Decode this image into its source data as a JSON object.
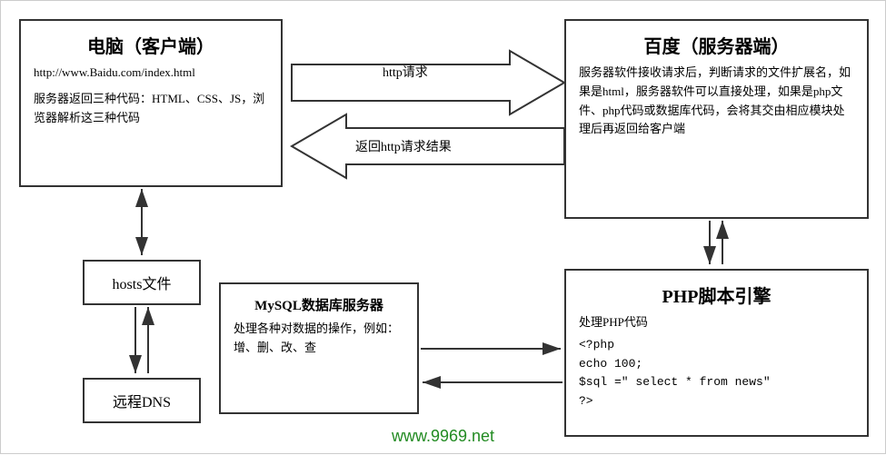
{
  "client": {
    "title": "电脑（客户端）",
    "url": "http://www.Baidu.com/index.html",
    "description": "服务器返回三种代码：HTML、CSS、JS，浏览器解析这三种代码"
  },
  "server": {
    "title": "百度（服务器端）",
    "description": "服务器软件接收请求后，判断请求的文件扩展名，如果是html，服务器软件可以直接处理，如果是php文件、php代码或数据库代码，会将其交由相应模块处理后再返回给客户端"
  },
  "hosts": {
    "label": "hosts文件"
  },
  "dns": {
    "label": "远程DNS"
  },
  "mysql": {
    "title": "MySQL数据库服务器",
    "description": "处理各种对数据的操作，例如：增、删、改、查"
  },
  "php": {
    "title": "PHP脚本引擎",
    "process": "处理PHP代码",
    "code_line1": "<?php",
    "code_line2": "  echo 100;",
    "code_line3": "  $sql =\" select * from news\"",
    "code_line4": "?>"
  },
  "arrows": {
    "http_request": "http请求",
    "http_response": "返回http请求结果"
  },
  "watermark": "www.9969.net"
}
